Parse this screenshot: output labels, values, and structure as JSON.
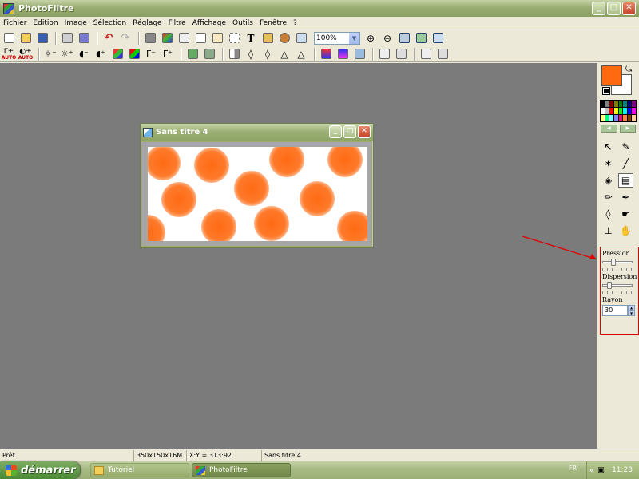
{
  "app": {
    "title": "PhotoFiltre",
    "controls": {
      "minimize": "_",
      "maximize": "□",
      "close": "✕"
    }
  },
  "menu": [
    "Fichier",
    "Edition",
    "Image",
    "Sélection",
    "Réglage",
    "Filtre",
    "Affichage",
    "Outils",
    "Fenêtre",
    "?"
  ],
  "toolbar": {
    "zoom_value": "100%",
    "auto_label": "AUTO",
    "text_tool_label": "T"
  },
  "colors": {
    "foreground": "#ff6a10",
    "background": "#ffffff",
    "palette": [
      "#000000",
      "#808080",
      "#800000",
      "#808000",
      "#008000",
      "#008080",
      "#000080",
      "#800080",
      "#ffffff",
      "#c0c0c0",
      "#ff0000",
      "#ffff00",
      "#00ff00",
      "#00ffff",
      "#0000ff",
      "#ff00ff",
      "#ffff80",
      "#00ff80",
      "#80ffff",
      "#8080ff",
      "#ff0080",
      "#ff8040",
      "#804000",
      "#ffcc99"
    ]
  },
  "tool_options": {
    "pressure_label": "Pression",
    "pressure_level": 0.35,
    "dispersion_label": "Dispersion",
    "dispersion_level": 0.2,
    "radius_label": "Rayon",
    "radius_value": "30"
  },
  "document": {
    "title": "Sans titre 4",
    "dot_color": "#ff6a14"
  },
  "status": {
    "state": "Prêt",
    "image_info": "350x150x16M",
    "coords": "X:Y = 313:92",
    "doc_name": "Sans titre 4"
  },
  "taskbar": {
    "start_label": "démarrer",
    "tasks": [
      "Tutoriel",
      "PhotoFiltre"
    ],
    "language": "FR",
    "clock": "11:23"
  },
  "annotation_color": "#e00000"
}
